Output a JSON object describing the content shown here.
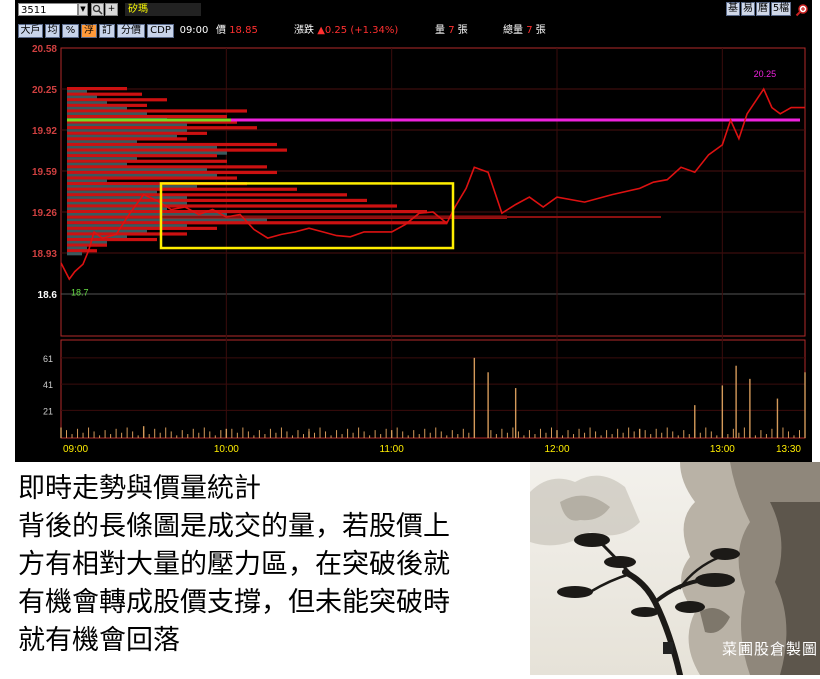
{
  "toolbar": {
    "symbol": "3511",
    "stock_name": "矽瑪",
    "right_buttons": [
      "基",
      "易",
      "曆",
      "5檔"
    ]
  },
  "infobar": {
    "buttons": [
      "大戶",
      "均",
      "%",
      "浮",
      "訂",
      "分價",
      "CDP"
    ],
    "active_button": "浮",
    "time": "09:00",
    "price_label": "價",
    "price": "18.85",
    "change_label": "漲跌",
    "change": "▲0.25 (+1.34%)",
    "volume_label": "量",
    "volume": "7",
    "volume_unit": "張",
    "total_volume_label": "總量",
    "total_volume": "7",
    "total_volume_unit": "張"
  },
  "chart": {
    "price_ticks": [
      "20.58",
      "20.25",
      "19.92",
      "19.59",
      "19.26",
      "18.93",
      "18.6"
    ],
    "high_label": "20.25",
    "low_label": "18.7",
    "volume_ticks": [
      "61",
      "41",
      "21"
    ],
    "time_ticks": [
      "09:00",
      "10:00",
      "11:00",
      "12:00",
      "13:00",
      "13:30"
    ],
    "colors": {
      "price_line": "#dd1111",
      "avg_line": "#ee22dd",
      "avg_line_early": "#77dd22",
      "profile_buy": "#cc1111",
      "profile_sell": "#3a5a5e",
      "highlight_box": "#ffee00",
      "volume_bars": "#d49a5a"
    }
  },
  "chart_data": {
    "type": "line",
    "title": "",
    "xlabel": "",
    "ylabel": "",
    "ylim": [
      18.6,
      20.58
    ],
    "x_ticks": [
      "09:00",
      "10:00",
      "11:00",
      "12:00",
      "13:00",
      "13:30"
    ],
    "session_high": 20.25,
    "session_low": 18.7,
    "price_series": [
      [
        "09:00",
        18.85
      ],
      [
        "09:03",
        18.72
      ],
      [
        "09:05",
        18.78
      ],
      [
        "09:08",
        18.84
      ],
      [
        "09:10",
        18.95
      ],
      [
        "09:12",
        19.1
      ],
      [
        "09:15",
        19.05
      ],
      [
        "09:20",
        19.08
      ],
      [
        "09:25",
        19.25
      ],
      [
        "09:30",
        19.4
      ],
      [
        "09:35",
        19.35
      ],
      [
        "09:40",
        19.28
      ],
      [
        "09:45",
        19.3
      ],
      [
        "09:50",
        19.24
      ],
      [
        "09:55",
        19.28
      ],
      [
        "10:00",
        19.22
      ],
      [
        "10:05",
        19.24
      ],
      [
        "10:10",
        19.12
      ],
      [
        "10:15",
        19.05
      ],
      [
        "10:20",
        19.08
      ],
      [
        "10:25",
        19.1
      ],
      [
        "10:30",
        19.13
      ],
      [
        "10:35",
        19.1
      ],
      [
        "10:40",
        19.07
      ],
      [
        "10:45",
        19.06
      ],
      [
        "10:50",
        19.1
      ],
      [
        "10:55",
        19.1
      ],
      [
        "11:00",
        19.1
      ],
      [
        "11:05",
        19.16
      ],
      [
        "11:10",
        19.25
      ],
      [
        "11:15",
        19.26
      ],
      [
        "11:20",
        19.17
      ],
      [
        "11:23",
        19.3
      ],
      [
        "11:27",
        19.45
      ],
      [
        "11:30",
        19.62
      ],
      [
        "11:35",
        19.58
      ],
      [
        "11:40",
        19.25
      ],
      [
        "11:45",
        19.32
      ],
      [
        "11:50",
        19.38
      ],
      [
        "11:55",
        19.3
      ],
      [
        "12:00",
        19.38
      ],
      [
        "12:10",
        19.34
      ],
      [
        "12:20",
        19.4
      ],
      [
        "12:30",
        19.45
      ],
      [
        "12:35",
        19.5
      ],
      [
        "12:40",
        19.52
      ],
      [
        "12:45",
        19.62
      ],
      [
        "12:50",
        19.58
      ],
      [
        "12:55",
        19.72
      ],
      [
        "13:00",
        19.8
      ],
      [
        "13:03",
        20.0
      ],
      [
        "13:06",
        19.85
      ],
      [
        "13:09",
        20.05
      ],
      [
        "13:12",
        20.15
      ],
      [
        "13:15",
        20.25
      ],
      [
        "13:18",
        20.1
      ],
      [
        "13:21",
        20.05
      ],
      [
        "13:25",
        20.1
      ],
      [
        "13:30",
        20.1
      ]
    ],
    "average_price": 20.0,
    "volume_series": [
      [
        "09:00",
        8
      ],
      [
        "09:30",
        9
      ],
      [
        "10:00",
        7
      ],
      [
        "10:30",
        5
      ],
      [
        "11:00",
        6
      ],
      [
        "11:30",
        61
      ],
      [
        "11:35",
        50
      ],
      [
        "11:45",
        38
      ],
      [
        "12:00",
        6
      ],
      [
        "12:30",
        7
      ],
      [
        "12:50",
        25
      ],
      [
        "13:00",
        40
      ],
      [
        "13:05",
        55
      ],
      [
        "13:10",
        45
      ],
      [
        "13:20",
        30
      ],
      [
        "13:30",
        50
      ]
    ],
    "volume_ylim": [
      0,
      70
    ]
  },
  "caption": {
    "lines": [
      "即時走勢與價量統計",
      "背後的長條圖是成交的量，若股價上",
      "方有相對大量的壓力區，在突破後就",
      "有機會轉成股價支撐，但未能突破時",
      "就有機會回落"
    ]
  },
  "painting": {
    "signature": "菜圃股倉製圖"
  }
}
